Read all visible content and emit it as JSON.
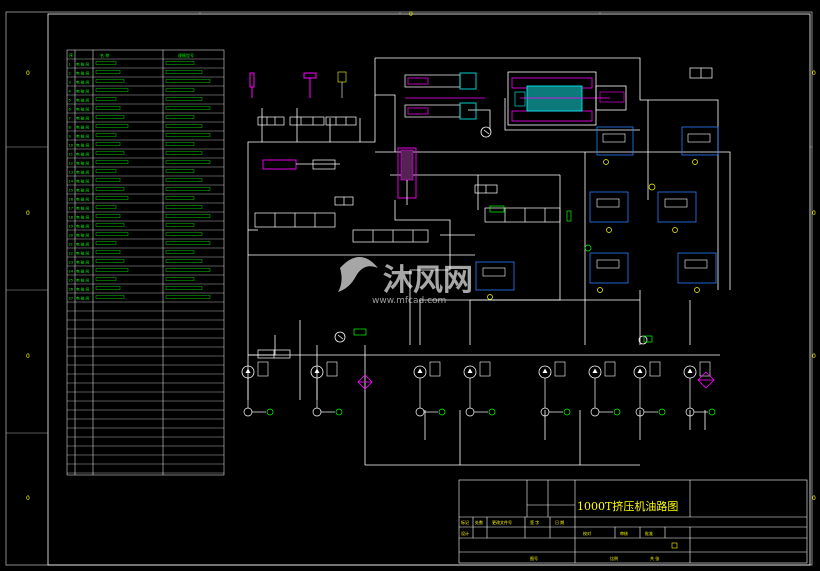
{
  "drawing_title": "1000T挤压机油路图",
  "watermark": {
    "brand": "沐风网",
    "url": "www.mfcad.com"
  },
  "frame_zone_letters_left": [
    "0",
    "0",
    "0",
    "0",
    "0"
  ],
  "frame_zone_letters_right": [
    "0",
    "0",
    "0",
    "0"
  ],
  "parts_table": {
    "header": [
      "序",
      "名 称",
      "规格型号"
    ],
    "rows": [
      [
        "1",
        "电 磁 阀",
        ""
      ],
      [
        "2",
        "电 磁 阀",
        ""
      ],
      [
        "3",
        "电 磁 阀",
        ""
      ],
      [
        "4",
        "电 磁 阀",
        ""
      ],
      [
        "5",
        "电 磁 阀",
        ""
      ],
      [
        "6",
        "电 磁 阀",
        ""
      ],
      [
        "7",
        "电 磁 阀",
        ""
      ],
      [
        "8",
        "电 磁 阀",
        ""
      ],
      [
        "9",
        "电 磁 阀",
        ""
      ],
      [
        "10",
        "电 磁 阀",
        ""
      ],
      [
        "11",
        "电 磁 阀",
        ""
      ],
      [
        "12",
        "电 磁 阀",
        ""
      ],
      [
        "13",
        "电 磁 阀",
        ""
      ],
      [
        "14",
        "电 磁 阀",
        ""
      ],
      [
        "15",
        "电 磁 阀",
        ""
      ],
      [
        "16",
        "电 磁 阀",
        ""
      ],
      [
        "17",
        "电 磁 阀",
        ""
      ],
      [
        "18",
        "电 磁 阀",
        ""
      ],
      [
        "19",
        "电 磁 阀",
        ""
      ],
      [
        "20",
        "电 磁 阀",
        ""
      ],
      [
        "21",
        "电 磁 阀",
        ""
      ],
      [
        "22",
        "电 磁 阀",
        ""
      ],
      [
        "23",
        "电 磁 阀",
        ""
      ],
      [
        "24",
        "电 磁 阀",
        ""
      ],
      [
        "25",
        "电 磁 阀",
        ""
      ],
      [
        "26",
        "电 磁 阀",
        ""
      ],
      [
        "27",
        "电 磁 阀",
        ""
      ]
    ]
  },
  "title_block": {
    "cells_row1": [
      "设计",
      "校对",
      "审核",
      "批准"
    ],
    "cells_row2": [
      "标记",
      "处数",
      "更改文件号",
      "签 字",
      "日 期"
    ],
    "scale_label": "比例",
    "sheet_label": "共 张",
    "drawing_no_label": "图号"
  },
  "colors": {
    "background": "#000000",
    "line": "#ffffff",
    "table_text": "#00ff00",
    "magenta": "#ff00ff",
    "cyan": "#00ffff",
    "blue": "#2a7fff",
    "yellow": "#ffff00",
    "red": "#ff3333"
  }
}
